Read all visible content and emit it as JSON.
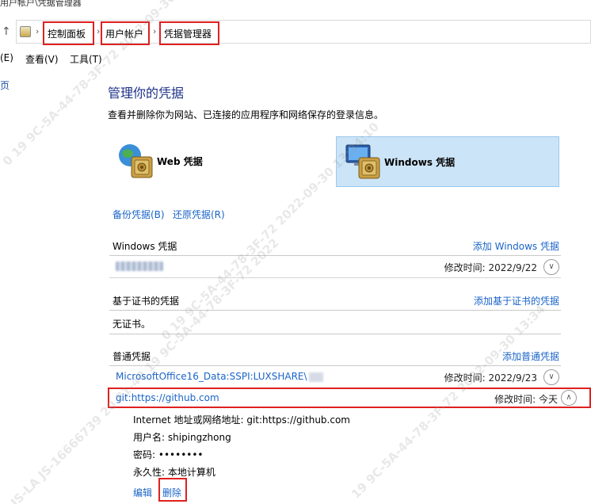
{
  "window": {
    "title": "用户帐户\\凭据管理器"
  },
  "address_bar": {
    "breadcrumbs": [
      "控制面板",
      "用户帐户",
      "凭据管理器"
    ],
    "separator": "›"
  },
  "menu": {
    "items": [
      "(E)",
      "查看(V)",
      "工具(T)"
    ]
  },
  "left_pane": {
    "text": "页"
  },
  "page": {
    "heading": "管理你的凭据",
    "subheading": "查看并删除你为网站、已连接的应用程序和网络保存的登录信息。"
  },
  "tiles": [
    {
      "label": "Web 凭据",
      "icon": "globe-vault-icon",
      "selected": false
    },
    {
      "label": "Windows 凭据",
      "icon": "monitor-vault-icon",
      "selected": true
    }
  ],
  "actions": {
    "backup": "备份凭据(B)",
    "restore": "还原凭据(R)"
  },
  "sections": {
    "windows": {
      "title": "Windows 凭据",
      "add": "添加 Windows 凭据",
      "rows": [
        {
          "mod_label": "修改时间:",
          "mod_value": "2022/9/22"
        }
      ]
    },
    "certificate": {
      "title": "基于证书的凭据",
      "add": "添加基于证书的凭据",
      "empty": "无证书。"
    },
    "generic": {
      "title": "普通凭据",
      "add": "添加普通凭据",
      "rows": [
        {
          "label": "MicrosoftOffice16_Data:SSPI:LUXSHARE\\",
          "mod_label": "修改时间:",
          "mod_value": "2022/9/23"
        },
        {
          "label": "git:https://github.com",
          "mod_label": "修改时间:",
          "mod_value": "今天",
          "expanded": true
        }
      ]
    }
  },
  "details": {
    "address_label": "Internet 地址或网络地址:",
    "address_value": "git:https://github.com",
    "user_label": "用户名:",
    "user_value": "shipingzhong",
    "password_label": "密码:",
    "password_value": "••••••••",
    "persistence_label": "永久性:",
    "persistence_value": "本地计算机",
    "edit": "编辑",
    "delete": "删除"
  },
  "colors": {
    "link": "#1a64c8",
    "heading": "#1e3287",
    "highlight_box": "#e02020",
    "selected_tile": "#cce4f7"
  }
}
